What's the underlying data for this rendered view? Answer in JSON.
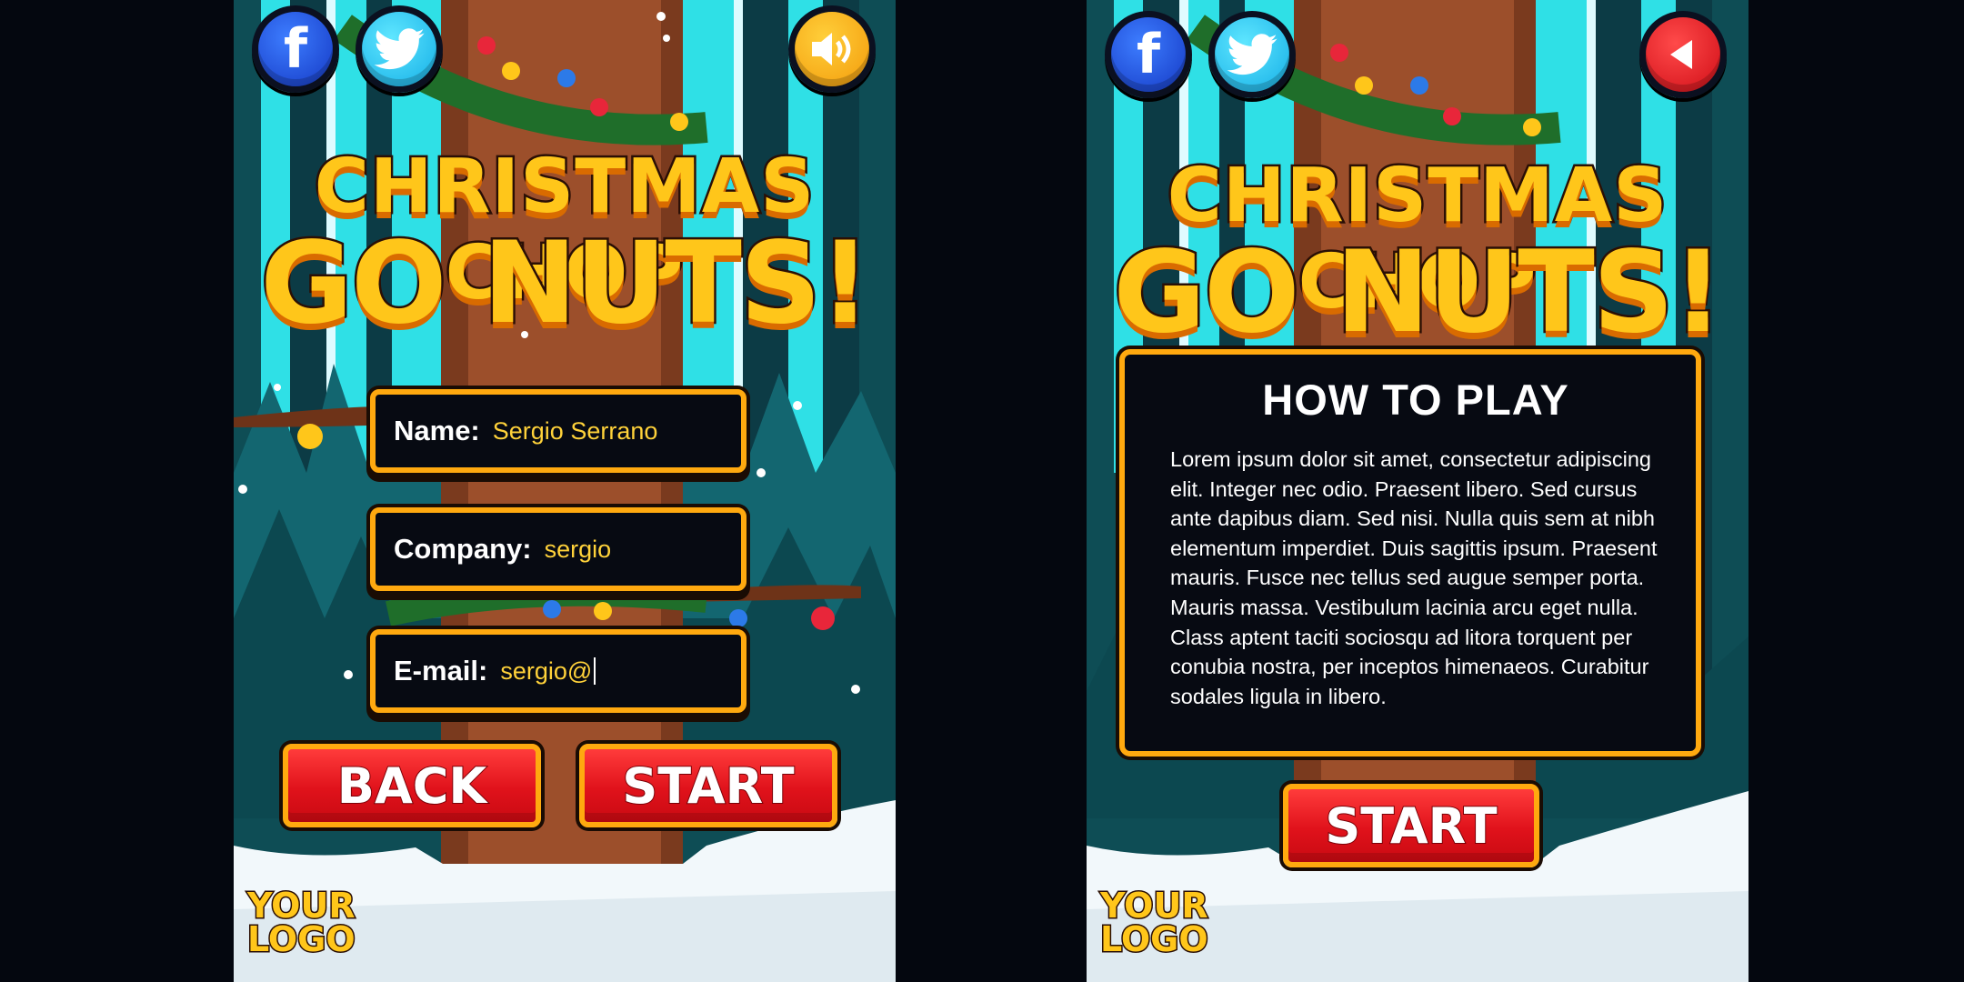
{
  "game": {
    "title_line1": "CHRISTMAS CHOP",
    "title_line2": "GO NUTS!"
  },
  "form_screen": {
    "social": {
      "facebook": "f"
    },
    "fields": [
      {
        "label": "Name:",
        "value": "Sergio Serrano"
      },
      {
        "label": "Company:",
        "value": "sergio"
      },
      {
        "label": "E-mail:",
        "value": "sergio@"
      }
    ],
    "back_label": "BACK",
    "start_label": "START",
    "logo_line1": "YOUR",
    "logo_line2": "LOGO"
  },
  "howto_screen": {
    "social": {
      "facebook": "f"
    },
    "heading": "HOW TO PLAY",
    "body": "Lorem ipsum dolor sit amet, consectetur adipiscing elit. Integer nec odio. Praesent libero. Sed cursus ante dapibus diam. Sed nisi. Nulla quis sem at nibh elementum imperdiet. Duis sagittis ipsum. Praesent mauris. Fusce nec tellus sed augue semper porta. Mauris massa. Vestibulum lacinia arcu eget nulla. Class aptent taciti sociosqu ad litora torquent per conubia nostra, per inceptos himenaeos. Curabitur sodales ligula in libero.",
    "start_label": "START",
    "logo_line1": "YOUR",
    "logo_line2": "LOGO"
  },
  "icons": [
    "facebook-icon",
    "twitter-icon",
    "sound-icon",
    "back-arrow-icon"
  ],
  "colors": {
    "background": "#04070f",
    "accent_gold": "#ffa90f",
    "title_yellow": "#ffc61a",
    "button_red": "#e0121b",
    "field_value": "#ffd23a",
    "sky_cyan": "#2ee0e6",
    "trunk_brown": "#a0522d",
    "facebook_blue": "#1f5ae8",
    "twitter_cyan": "#27c4f2",
    "sound_orange": "#f7b11c"
  }
}
